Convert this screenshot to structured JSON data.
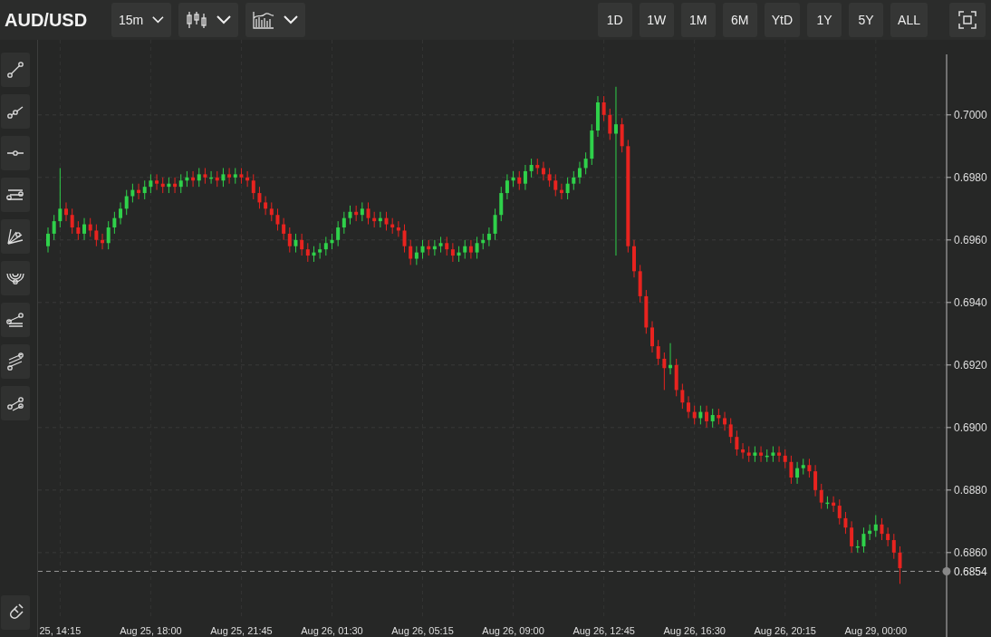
{
  "symbol": "AUD/USD",
  "toolbar": [
    {
      "kind": "interval",
      "label": "15m"
    },
    {
      "kind": "candles"
    },
    {
      "kind": "indicators"
    }
  ],
  "ranges": [
    "1D",
    "1W",
    "1M",
    "6M",
    "YtD",
    "1Y",
    "5Y",
    "ALL"
  ],
  "drawing_tools": [
    {
      "kind": "trendline"
    },
    {
      "kind": "ray"
    },
    {
      "kind": "hline"
    },
    {
      "kind": "channel"
    },
    {
      "kind": "fan"
    },
    {
      "kind": "arcs"
    },
    {
      "kind": "pitchfork"
    },
    {
      "kind": "lines"
    },
    {
      "kind": "path"
    }
  ],
  "chart": {
    "chart_data": {
      "type": "candlestick",
      "ylim": [
        0.6833,
        0.7024
      ],
      "grid": true,
      "yticks": [
        {
          "value": 0.686,
          "label": "0.6860"
        },
        {
          "value": 0.688,
          "label": "0.6880"
        },
        {
          "value": 0.69,
          "label": "0.6900"
        },
        {
          "value": 0.692,
          "label": "0.6920"
        },
        {
          "value": 0.694,
          "label": "0.6940"
        },
        {
          "value": 0.696,
          "label": "0.6960"
        },
        {
          "value": 0.698,
          "label": "0.6980"
        },
        {
          "value": 0.7,
          "label": "0.7000"
        }
      ],
      "categories": [
        null,
        null,
        "25, 14:15",
        null,
        null,
        null,
        null,
        null,
        null,
        null,
        null,
        null,
        null,
        null,
        null,
        null,
        null,
        "Aug 25, 18:00",
        null,
        null,
        null,
        null,
        null,
        null,
        null,
        null,
        null,
        null,
        null,
        null,
        null,
        null,
        "Aug 25, 21:45",
        null,
        null,
        null,
        null,
        null,
        null,
        null,
        null,
        null,
        null,
        null,
        null,
        null,
        null,
        "Aug 26, 01:30",
        null,
        null,
        null,
        null,
        null,
        null,
        null,
        null,
        null,
        null,
        null,
        null,
        null,
        null,
        "Aug 26, 05:15",
        null,
        null,
        null,
        null,
        null,
        null,
        null,
        null,
        null,
        null,
        null,
        null,
        null,
        null,
        "Aug 26, 09:00",
        null,
        null,
        null,
        null,
        null,
        null,
        null,
        null,
        null,
        null,
        null,
        null,
        null,
        null,
        "Aug 26, 12:45",
        null,
        null,
        null,
        null,
        null,
        null,
        null,
        null,
        null,
        null,
        null,
        null,
        null,
        null,
        "Aug 26, 16:30",
        null,
        null,
        null,
        null,
        null,
        null,
        null,
        null,
        null,
        null,
        null,
        null,
        null,
        null,
        "Aug 26, 20:15",
        null,
        null,
        null,
        null,
        null,
        null,
        null,
        null,
        null,
        null,
        null,
        null,
        null,
        null,
        "Aug 29, 00:00",
        null,
        null,
        null,
        null
      ],
      "ohlc": [
        [
          0.6958,
          0.6964,
          0.6956,
          0.6962
        ],
        [
          0.6962,
          0.6968,
          0.696,
          0.6966
        ],
        [
          0.6966,
          0.6983,
          0.6964,
          0.697
        ],
        [
          0.697,
          0.6972,
          0.6966,
          0.6968
        ],
        [
          0.6968,
          0.697,
          0.6962,
          0.6964
        ],
        [
          0.6964,
          0.6966,
          0.696,
          0.6962
        ],
        [
          0.6962,
          0.6967,
          0.696,
          0.6965
        ],
        [
          0.6965,
          0.6967,
          0.6961,
          0.6963
        ],
        [
          0.6963,
          0.6965,
          0.6958,
          0.696
        ],
        [
          0.696,
          0.6962,
          0.6957,
          0.6959
        ],
        [
          0.6959,
          0.6966,
          0.6957,
          0.6964
        ],
        [
          0.6964,
          0.6969,
          0.6962,
          0.6967
        ],
        [
          0.6967,
          0.6972,
          0.6965,
          0.697
        ],
        [
          0.697,
          0.6976,
          0.6968,
          0.6974
        ],
        [
          0.6974,
          0.6978,
          0.6972,
          0.6976
        ],
        [
          0.6976,
          0.6978,
          0.6973,
          0.6975
        ],
        [
          0.6975,
          0.6979,
          0.6973,
          0.6977
        ],
        [
          0.6977,
          0.6981,
          0.6975,
          0.6979
        ],
        [
          0.6979,
          0.6981,
          0.6976,
          0.6978
        ],
        [
          0.6978,
          0.698,
          0.6975,
          0.6977
        ],
        [
          0.6977,
          0.698,
          0.6975,
          0.6978
        ],
        [
          0.6978,
          0.698,
          0.6975,
          0.6977
        ],
        [
          0.6977,
          0.6981,
          0.6975,
          0.6979
        ],
        [
          0.6979,
          0.6982,
          0.6977,
          0.698
        ],
        [
          0.698,
          0.6982,
          0.6977,
          0.6979
        ],
        [
          0.6979,
          0.6983,
          0.6977,
          0.6981
        ],
        [
          0.6981,
          0.6983,
          0.6978,
          0.698
        ],
        [
          0.698,
          0.6982,
          0.6978,
          0.698
        ],
        [
          0.698,
          0.6982,
          0.6977,
          0.6979
        ],
        [
          0.6979,
          0.6983,
          0.6977,
          0.6981
        ],
        [
          0.6981,
          0.6983,
          0.6978,
          0.698
        ],
        [
          0.698,
          0.6983,
          0.6978,
          0.6981
        ],
        [
          0.6981,
          0.6983,
          0.6978,
          0.698
        ],
        [
          0.698,
          0.6982,
          0.6977,
          0.6979
        ],
        [
          0.6979,
          0.6981,
          0.6973,
          0.6975
        ],
        [
          0.6975,
          0.6977,
          0.697,
          0.6972
        ],
        [
          0.6972,
          0.6974,
          0.6968,
          0.697
        ],
        [
          0.697,
          0.6972,
          0.6966,
          0.6968
        ],
        [
          0.6968,
          0.697,
          0.6963,
          0.6965
        ],
        [
          0.6965,
          0.6967,
          0.696,
          0.6962
        ],
        [
          0.6962,
          0.6964,
          0.6956,
          0.6958
        ],
        [
          0.6958,
          0.6962,
          0.6956,
          0.696
        ],
        [
          0.696,
          0.6962,
          0.6955,
          0.6957
        ],
        [
          0.6957,
          0.6959,
          0.6953,
          0.6955
        ],
        [
          0.6955,
          0.6958,
          0.6953,
          0.6956
        ],
        [
          0.6956,
          0.6959,
          0.6954,
          0.6957
        ],
        [
          0.6957,
          0.6961,
          0.6955,
          0.6959
        ],
        [
          0.6959,
          0.6962,
          0.6957,
          0.696
        ],
        [
          0.696,
          0.6966,
          0.6958,
          0.6964
        ],
        [
          0.6964,
          0.6969,
          0.6962,
          0.6967
        ],
        [
          0.6967,
          0.6971,
          0.6965,
          0.6969
        ],
        [
          0.6969,
          0.6971,
          0.6966,
          0.6968
        ],
        [
          0.6968,
          0.6972,
          0.6966,
          0.697
        ],
        [
          0.697,
          0.6972,
          0.6965,
          0.6967
        ],
        [
          0.6967,
          0.6969,
          0.6964,
          0.6966
        ],
        [
          0.6966,
          0.6969,
          0.6964,
          0.6967
        ],
        [
          0.6967,
          0.6969,
          0.6963,
          0.6965
        ],
        [
          0.6965,
          0.6967,
          0.6962,
          0.6964
        ],
        [
          0.6964,
          0.6966,
          0.6961,
          0.6963
        ],
        [
          0.6963,
          0.6965,
          0.6956,
          0.6958
        ],
        [
          0.6958,
          0.696,
          0.6952,
          0.6954
        ],
        [
          0.6954,
          0.6958,
          0.6952,
          0.6956
        ],
        [
          0.6956,
          0.696,
          0.6954,
          0.6958
        ],
        [
          0.6958,
          0.696,
          0.6955,
          0.6957
        ],
        [
          0.6957,
          0.696,
          0.6955,
          0.6958
        ],
        [
          0.6958,
          0.6961,
          0.6956,
          0.6959
        ],
        [
          0.6959,
          0.6961,
          0.6955,
          0.6957
        ],
        [
          0.6957,
          0.6959,
          0.6953,
          0.6955
        ],
        [
          0.6955,
          0.6958,
          0.6953,
          0.6956
        ],
        [
          0.6956,
          0.696,
          0.6954,
          0.6958
        ],
        [
          0.6958,
          0.696,
          0.6954,
          0.6956
        ],
        [
          0.6956,
          0.6961,
          0.6954,
          0.6959
        ],
        [
          0.6959,
          0.6962,
          0.6957,
          0.696
        ],
        [
          0.696,
          0.6964,
          0.6958,
          0.6962
        ],
        [
          0.6962,
          0.697,
          0.696,
          0.6968
        ],
        [
          0.6968,
          0.6977,
          0.6966,
          0.6975
        ],
        [
          0.6975,
          0.6981,
          0.6973,
          0.6979
        ],
        [
          0.6979,
          0.6982,
          0.6977,
          0.698
        ],
        [
          0.698,
          0.6982,
          0.6976,
          0.6978
        ],
        [
          0.6978,
          0.6984,
          0.6976,
          0.6982
        ],
        [
          0.6982,
          0.6986,
          0.698,
          0.6984
        ],
        [
          0.6984,
          0.6986,
          0.6981,
          0.6983
        ],
        [
          0.6983,
          0.6985,
          0.6979,
          0.6981
        ],
        [
          0.6981,
          0.6983,
          0.6977,
          0.6979
        ],
        [
          0.6979,
          0.6981,
          0.6974,
          0.6976
        ],
        [
          0.6976,
          0.6978,
          0.6973,
          0.6975
        ],
        [
          0.6975,
          0.698,
          0.6973,
          0.6978
        ],
        [
          0.6978,
          0.6982,
          0.6976,
          0.698
        ],
        [
          0.698,
          0.6985,
          0.6978,
          0.6983
        ],
        [
          0.6983,
          0.6988,
          0.6981,
          0.6986
        ],
        [
          0.6986,
          0.6997,
          0.6984,
          0.6995
        ],
        [
          0.6995,
          0.7006,
          0.6993,
          0.7004
        ],
        [
          0.7004,
          0.7006,
          0.6998,
          0.7
        ],
        [
          0.7,
          0.7002,
          0.6992,
          0.6994
        ],
        [
          0.6994,
          0.7009,
          0.6955,
          0.6997
        ],
        [
          0.6997,
          0.6999,
          0.6988,
          0.699
        ],
        [
          0.699,
          0.6992,
          0.6956,
          0.6958
        ],
        [
          0.6958,
          0.696,
          0.6948,
          0.695
        ],
        [
          0.695,
          0.6952,
          0.694,
          0.6942
        ],
        [
          0.6942,
          0.6944,
          0.693,
          0.6932
        ],
        [
          0.6932,
          0.6934,
          0.6924,
          0.6926
        ],
        [
          0.6926,
          0.6928,
          0.692,
          0.6922
        ],
        [
          0.6922,
          0.6924,
          0.6912,
          0.6919
        ],
        [
          0.6919,
          0.6927,
          0.6917,
          0.692
        ],
        [
          0.692,
          0.6922,
          0.691,
          0.6912
        ],
        [
          0.6912,
          0.6914,
          0.6906,
          0.6908
        ],
        [
          0.6908,
          0.691,
          0.6903,
          0.6905
        ],
        [
          0.6905,
          0.6907,
          0.6901,
          0.6903
        ],
        [
          0.6903,
          0.6907,
          0.6901,
          0.6905
        ],
        [
          0.6905,
          0.6907,
          0.69,
          0.6902
        ],
        [
          0.6902,
          0.6906,
          0.69,
          0.6904
        ],
        [
          0.6904,
          0.6906,
          0.6901,
          0.6903
        ],
        [
          0.6903,
          0.6905,
          0.6899,
          0.6901
        ],
        [
          0.6901,
          0.6903,
          0.6895,
          0.6897
        ],
        [
          0.6897,
          0.6899,
          0.6891,
          0.6893
        ],
        [
          0.6893,
          0.6895,
          0.689,
          0.6892
        ],
        [
          0.6892,
          0.6894,
          0.6889,
          0.6891
        ],
        [
          0.6891,
          0.6894,
          0.6889,
          0.6892
        ],
        [
          0.6892,
          0.6894,
          0.6889,
          0.6891
        ],
        [
          0.6891,
          0.6893,
          0.6889,
          0.6891
        ],
        [
          0.6891,
          0.6894,
          0.6889,
          0.6892
        ],
        [
          0.6892,
          0.6894,
          0.6889,
          0.6891
        ],
        [
          0.6891,
          0.6893,
          0.6887,
          0.6889
        ],
        [
          0.6889,
          0.6891,
          0.6882,
          0.6884
        ],
        [
          0.6884,
          0.6889,
          0.6882,
          0.6887
        ],
        [
          0.6887,
          0.689,
          0.6885,
          0.6888
        ],
        [
          0.6888,
          0.689,
          0.6884,
          0.6886
        ],
        [
          0.6886,
          0.6888,
          0.6878,
          0.688
        ],
        [
          0.688,
          0.6882,
          0.6874,
          0.6876
        ],
        [
          0.6876,
          0.6878,
          0.6874,
          0.6876
        ],
        [
          0.6876,
          0.6878,
          0.6873,
          0.6875
        ],
        [
          0.6875,
          0.6877,
          0.6869,
          0.6871
        ],
        [
          0.6871,
          0.6873,
          0.6866,
          0.6868
        ],
        [
          0.6868,
          0.687,
          0.686,
          0.6862
        ],
        [
          0.6862,
          0.6864,
          0.686,
          0.6862
        ],
        [
          0.6862,
          0.6868,
          0.686,
          0.6866
        ],
        [
          0.6866,
          0.6869,
          0.6864,
          0.6867
        ],
        [
          0.6867,
          0.6872,
          0.6865,
          0.6869
        ],
        [
          0.6869,
          0.6871,
          0.6864,
          0.6866
        ],
        [
          0.6866,
          0.6868,
          0.6862,
          0.6864
        ],
        [
          0.6864,
          0.6866,
          0.6858,
          0.686
        ],
        [
          0.686,
          0.6862,
          0.685,
          0.6855
        ]
      ],
      "ref_lines": [
        {
          "axis": "y",
          "value": 0.6854,
          "label": "0.6854"
        }
      ]
    }
  }
}
